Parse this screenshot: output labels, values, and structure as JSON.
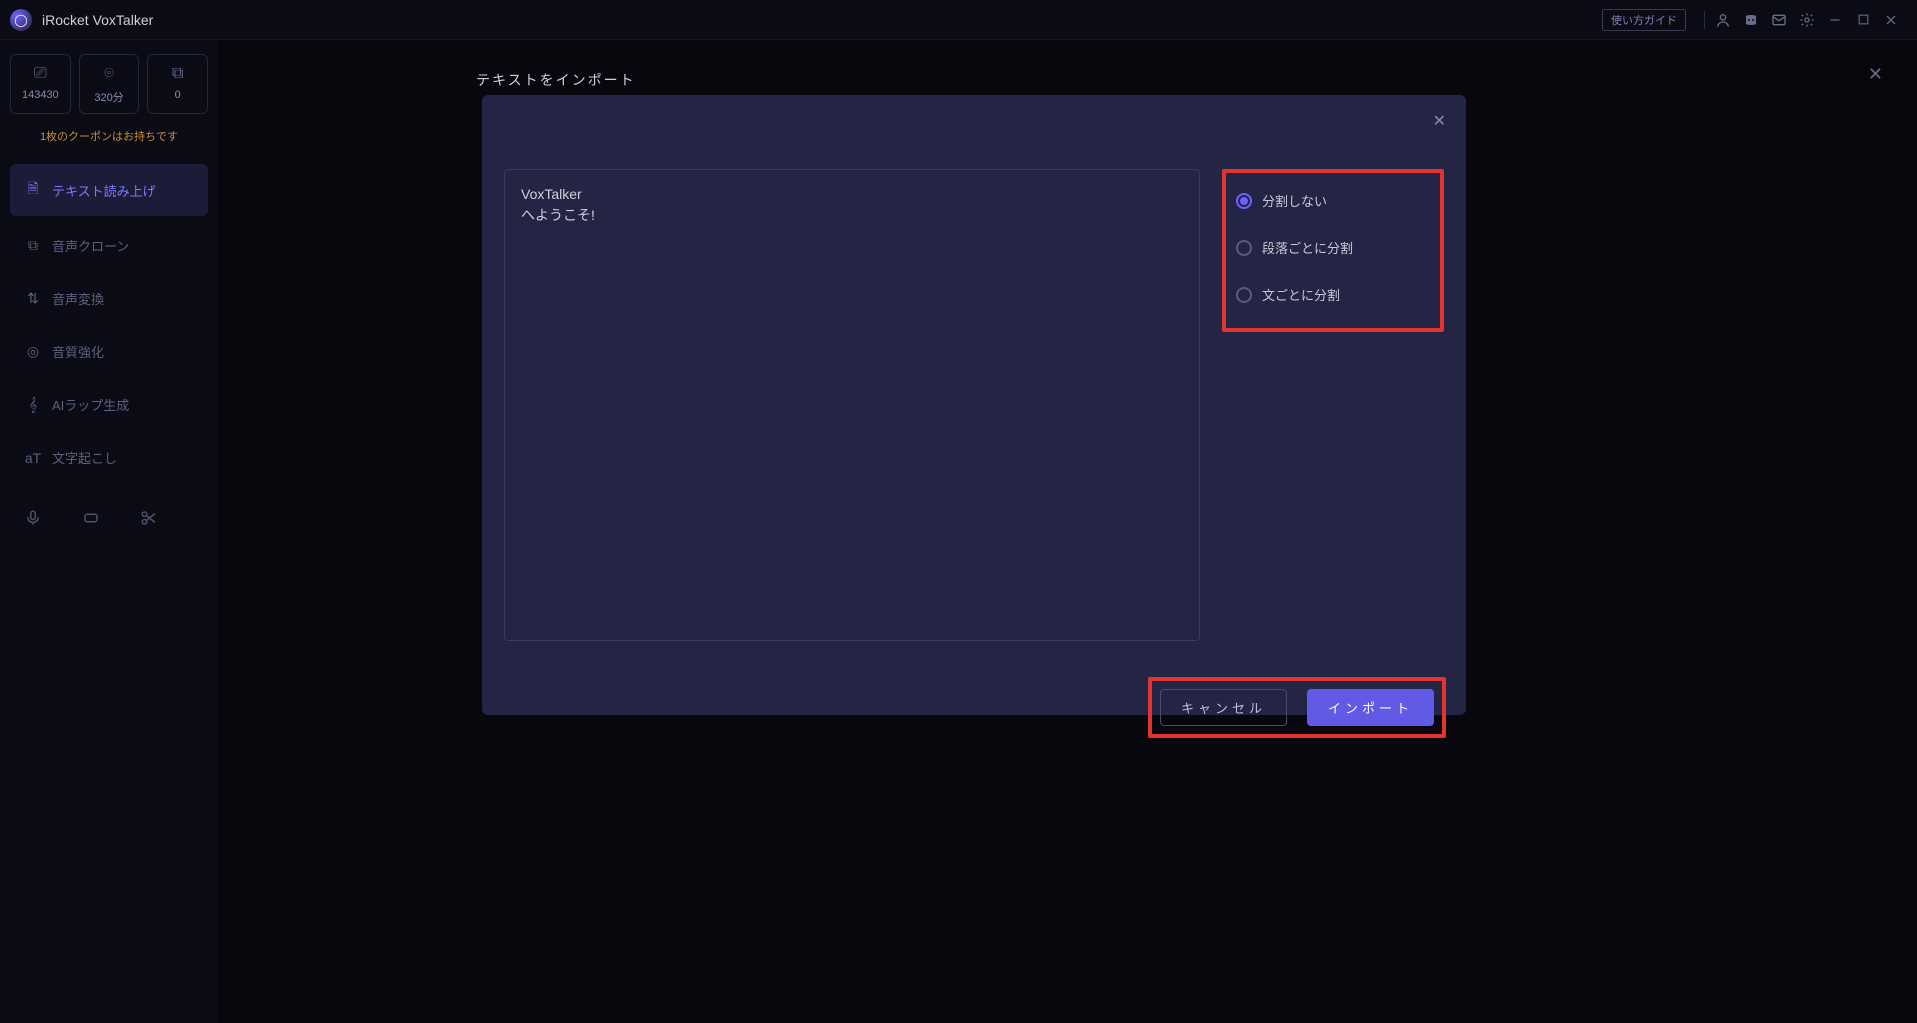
{
  "titlebar": {
    "app_name": "iRocket VoxTalker",
    "guide_label": "使い方ガイド"
  },
  "sidebar": {
    "stats": [
      {
        "icon": "⎚",
        "value": "143430"
      },
      {
        "icon": "⌾",
        "value": "320分"
      },
      {
        "icon": "⧉",
        "value": "0"
      }
    ],
    "coupon_text": "1枚のクーポンはお持ちです",
    "items": [
      {
        "icon": "🗎",
        "label": "テキスト読み上げ",
        "active": true
      },
      {
        "icon": "⧉",
        "label": "音声クローン",
        "active": false
      },
      {
        "icon": "⇅",
        "label": "音声変換",
        "active": false
      },
      {
        "icon": "◎",
        "label": "音質強化",
        "active": false
      },
      {
        "icon": "𝄞",
        "label": "AIラップ生成",
        "active": false
      },
      {
        "icon": "aT",
        "label": "文字起こし",
        "active": false
      }
    ]
  },
  "modal": {
    "title": "テキストをインポート",
    "text_content": "VoxTalker\nへようこそ!",
    "options": [
      {
        "label": "分割しない",
        "selected": true
      },
      {
        "label": "段落ごとに分割",
        "selected": false
      },
      {
        "label": "文ごとに分割",
        "selected": false
      }
    ],
    "cancel_label": "キャンセル",
    "import_label": "インポート"
  },
  "highlight_color": "#e2342f",
  "accent_color": "#605ae6"
}
